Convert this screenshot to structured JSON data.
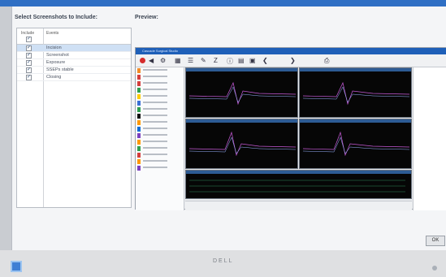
{
  "dialog": {
    "select_title": "Select Screenshots to Include:",
    "preview_title": "Preview:",
    "ok_label": "OK"
  },
  "events_table": {
    "headers": [
      "Include",
      "Events"
    ],
    "rows": [
      {
        "label": "Incision",
        "checked": true,
        "selected": true
      },
      {
        "label": "Screenshot",
        "checked": true,
        "selected": false
      },
      {
        "label": "Exposure",
        "checked": true,
        "selected": false
      },
      {
        "label": "SSEPs stable",
        "checked": true,
        "selected": false
      },
      {
        "label": "Closing",
        "checked": true,
        "selected": false
      }
    ]
  },
  "preview": {
    "window_title": "Cascade Surgical Studio",
    "toolbar_icons": [
      "record-icon",
      "speaker-icon",
      "settings-icon",
      "grid-icon",
      "list-icon",
      "pen-icon",
      "zoom-icon",
      "info-icon",
      "calendar-icon",
      "camera-icon",
      "prev-icon",
      "next-icon",
      "print-icon"
    ],
    "channel_colors": [
      "#f28c28",
      "#d43d3d",
      "#d43d3d",
      "#2e9e4f",
      "#ffcc00",
      "#3a6fd6",
      "#2e9e4f",
      "#111111",
      "#ff9900",
      "#0b6bd6",
      "#7b3fbf",
      "#ff9900",
      "#2e9e4f",
      "#d43d3d",
      "#ff9900",
      "#7b3fbf"
    ]
  },
  "footer": {
    "monitor_brand": "DELL"
  }
}
